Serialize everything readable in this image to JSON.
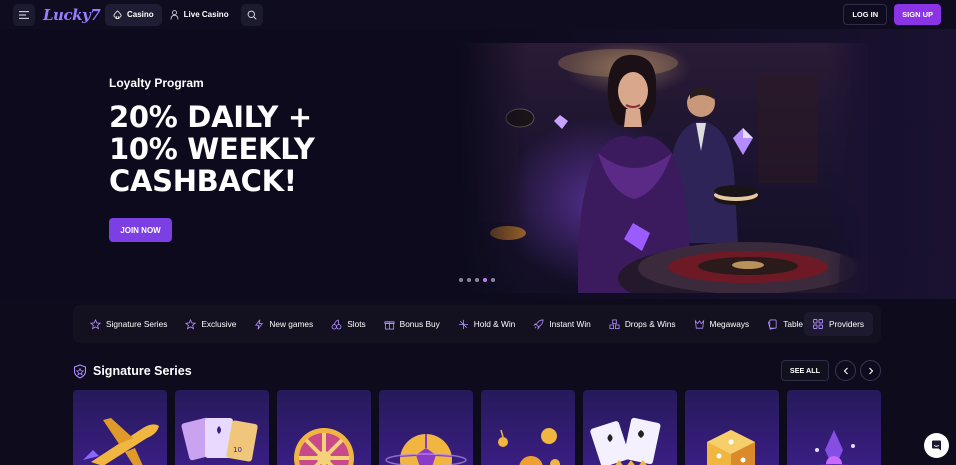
{
  "header": {
    "logo_text": "Lucky7",
    "tabs": [
      {
        "label": "Casino",
        "icon": "spade-icon",
        "active": true
      },
      {
        "label": "Live Casino",
        "icon": "dealer-icon",
        "active": false
      }
    ],
    "login_label": "LOG IN",
    "signup_label": "SIGN UP"
  },
  "hero": {
    "label": "Loyalty Program",
    "headline_lines": [
      "20% DAILY +",
      "10% WEEKLY",
      "CASHBACK!"
    ],
    "cta_label": "JOIN NOW",
    "slides_count": 5,
    "active_slide": 4
  },
  "categories": [
    {
      "label": "Signature Series",
      "icon": "star-icon"
    },
    {
      "label": "Exclusive",
      "icon": "star-icon"
    },
    {
      "label": "New games",
      "icon": "lightning-icon"
    },
    {
      "label": "Slots",
      "icon": "cherry-icon"
    },
    {
      "label": "Bonus Buy",
      "icon": "gift-icon"
    },
    {
      "label": "Hold & Win",
      "icon": "grid-icon"
    },
    {
      "label": "Instant Win",
      "icon": "rocket-icon"
    },
    {
      "label": "Drops & Wins",
      "icon": "blocks-icon"
    },
    {
      "label": "Megaways",
      "icon": "crown-icon"
    },
    {
      "label": "Table Games",
      "icon": "cards-icon"
    }
  ],
  "providers_label": "Providers",
  "section": {
    "title": "Signature Series",
    "see_all_label": "SEE ALL"
  },
  "game_cards": [
    {
      "icon": "plane-icon"
    },
    {
      "icon": "playing-cards-icon"
    },
    {
      "icon": "wheel-icon"
    },
    {
      "icon": "football-icon"
    },
    {
      "icon": "bomb-icon"
    },
    {
      "icon": "card-deck-icon"
    },
    {
      "icon": "dice-icon"
    },
    {
      "icon": "crystal-icon"
    }
  ],
  "colors": {
    "background": "#0d0b1c",
    "accent": "#8b34e6",
    "card_purple": "#3b1e86"
  }
}
